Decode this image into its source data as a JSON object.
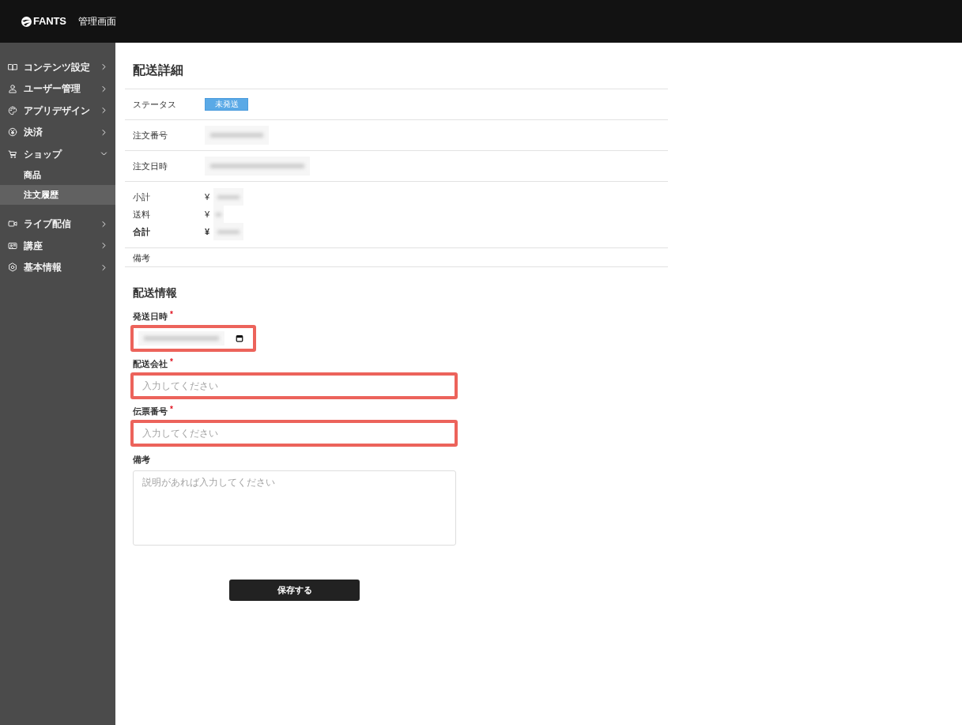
{
  "header": {
    "logo": "FANTS",
    "title": "管理画面"
  },
  "sidebar": {
    "items": [
      {
        "label": "コンテンツ設定",
        "expanded": false,
        "selected": false
      },
      {
        "label": "ユーザー管理",
        "expanded": false,
        "selected": false
      },
      {
        "label": "アプリデザイン",
        "expanded": false,
        "selected": false
      },
      {
        "label": "決済",
        "expanded": false,
        "selected": false
      },
      {
        "label": "ショップ",
        "expanded": true,
        "selected": false,
        "children": [
          {
            "label": "商品",
            "selected": false
          },
          {
            "label": "注文履歴",
            "selected": true
          }
        ]
      },
      {
        "label": "ライブ配信",
        "expanded": false,
        "selected": false
      },
      {
        "label": "講座",
        "expanded": false,
        "selected": false
      },
      {
        "label": "基本情報",
        "expanded": false,
        "selected": false
      }
    ]
  },
  "detail": {
    "title": "配送詳細",
    "rows": [
      {
        "kind": "badge",
        "label": "ステータス",
        "badge": "未発送"
      },
      {
        "kind": "blurred",
        "label": "注文番号"
      },
      {
        "kind": "blurred",
        "label": "注文日時"
      },
      {
        "kind": "amounts",
        "lines": [
          {
            "kind": "line",
            "label": "小計",
            "currency": "¥"
          },
          {
            "kind": "line",
            "label": "送料",
            "currency": "¥"
          },
          {
            "kind": "total",
            "label": "合計",
            "currency": "¥"
          }
        ]
      },
      {
        "kind": "empty",
        "label": "備考"
      }
    ]
  },
  "form": {
    "title": "配送情報",
    "required_mark": "*",
    "fields": [
      {
        "kind": "date",
        "label": "発送日時",
        "required": true,
        "highlighted": true
      },
      {
        "kind": "text",
        "label": "配送会社",
        "required": true,
        "highlighted": true,
        "placeholder": "入力してください"
      },
      {
        "kind": "text",
        "label": "伝票番号",
        "required": true,
        "highlighted": true,
        "placeholder": "入力してください"
      },
      {
        "kind": "textarea",
        "label": "備考",
        "required": false,
        "highlighted": false,
        "placeholder": "説明があれば入力してください"
      }
    ]
  },
  "save_button": {
    "label": "保存する"
  }
}
